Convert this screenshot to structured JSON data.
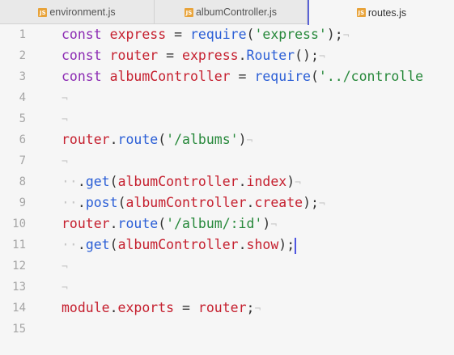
{
  "tabs": [
    {
      "icon_label": "JS",
      "label": "environment.js",
      "active": false
    },
    {
      "icon_label": "JS",
      "label": "albumController.js",
      "active": false
    },
    {
      "icon_label": "JS",
      "label": "routes.js",
      "active": true
    }
  ],
  "editor": {
    "language": "javascript",
    "cursor_line": 11,
    "lines": [
      {
        "number": "1",
        "tokens": [
          [
            "keyword",
            "const"
          ],
          [
            "op",
            " "
          ],
          [
            "ident",
            "express"
          ],
          [
            "op",
            " = "
          ],
          [
            "func",
            "require"
          ],
          [
            "op",
            "("
          ],
          [
            "string",
            "'express'"
          ],
          [
            "op",
            ");"
          ],
          [
            "nl",
            "¬"
          ]
        ]
      },
      {
        "number": "2",
        "tokens": [
          [
            "keyword",
            "const"
          ],
          [
            "op",
            " "
          ],
          [
            "ident",
            "router"
          ],
          [
            "op",
            " = "
          ],
          [
            "ident",
            "express"
          ],
          [
            "op",
            "."
          ],
          [
            "func",
            "Router"
          ],
          [
            "op",
            "();"
          ],
          [
            "nl",
            "¬"
          ]
        ]
      },
      {
        "number": "3",
        "tokens": [
          [
            "keyword",
            "const"
          ],
          [
            "op",
            " "
          ],
          [
            "ident",
            "albumController"
          ],
          [
            "op",
            " = "
          ],
          [
            "func",
            "require"
          ],
          [
            "op",
            "("
          ],
          [
            "string",
            "'../controlle"
          ]
        ]
      },
      {
        "number": "4",
        "tokens": [
          [
            "nl",
            "¬"
          ]
        ]
      },
      {
        "number": "5",
        "tokens": [
          [
            "nl",
            "¬"
          ]
        ]
      },
      {
        "number": "6",
        "tokens": [
          [
            "ident",
            "router"
          ],
          [
            "op",
            "."
          ],
          [
            "func",
            "route"
          ],
          [
            "op",
            "("
          ],
          [
            "string",
            "'/albums'"
          ],
          [
            "op",
            ")"
          ],
          [
            "nl",
            "¬"
          ]
        ]
      },
      {
        "number": "7",
        "tokens": [
          [
            "nl",
            "¬"
          ]
        ]
      },
      {
        "number": "8",
        "tokens": [
          [
            "ws",
            "··"
          ],
          [
            "op",
            "."
          ],
          [
            "func",
            "get"
          ],
          [
            "op",
            "("
          ],
          [
            "ident",
            "albumController"
          ],
          [
            "op",
            "."
          ],
          [
            "ident",
            "index"
          ],
          [
            "op",
            ")"
          ],
          [
            "nl",
            "¬"
          ]
        ]
      },
      {
        "number": "9",
        "tokens": [
          [
            "ws",
            "··"
          ],
          [
            "op",
            "."
          ],
          [
            "func",
            "post"
          ],
          [
            "op",
            "("
          ],
          [
            "ident",
            "albumController"
          ],
          [
            "op",
            "."
          ],
          [
            "ident",
            "create"
          ],
          [
            "op",
            ");"
          ],
          [
            "nl",
            "¬"
          ]
        ]
      },
      {
        "number": "10",
        "tokens": [
          [
            "ident",
            "router"
          ],
          [
            "op",
            "."
          ],
          [
            "func",
            "route"
          ],
          [
            "op",
            "("
          ],
          [
            "string",
            "'/album/:id'"
          ],
          [
            "op",
            ")"
          ],
          [
            "nl",
            "¬"
          ]
        ]
      },
      {
        "number": "11",
        "tokens": [
          [
            "ws",
            "··"
          ],
          [
            "op",
            "."
          ],
          [
            "func",
            "get"
          ],
          [
            "op",
            "("
          ],
          [
            "ident",
            "albumController"
          ],
          [
            "op",
            "."
          ],
          [
            "ident",
            "show"
          ],
          [
            "op",
            ");"
          ]
        ]
      },
      {
        "number": "12",
        "tokens": [
          [
            "nl",
            "¬"
          ]
        ]
      },
      {
        "number": "13",
        "tokens": [
          [
            "nl",
            "¬"
          ]
        ]
      },
      {
        "number": "14",
        "tokens": [
          [
            "ident",
            "module"
          ],
          [
            "op",
            "."
          ],
          [
            "ident",
            "exports"
          ],
          [
            "op",
            " = "
          ],
          [
            "ident",
            "router"
          ],
          [
            "op",
            ";"
          ],
          [
            "nl",
            "¬"
          ]
        ]
      },
      {
        "number": "15",
        "tokens": []
      }
    ]
  }
}
